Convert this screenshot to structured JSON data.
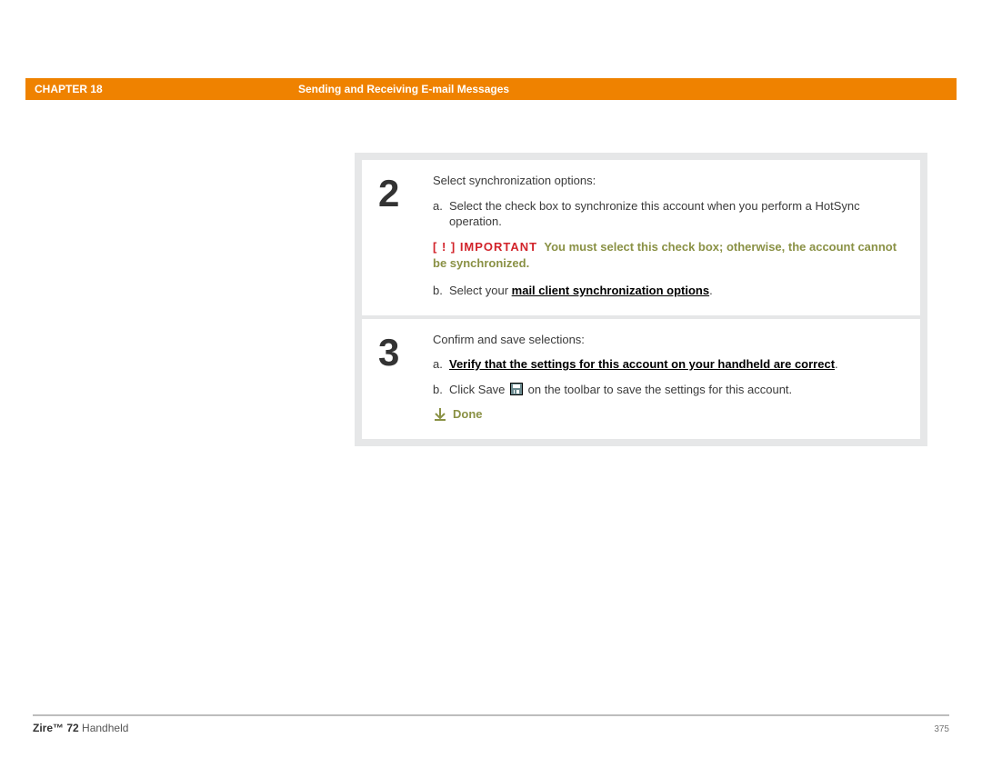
{
  "header": {
    "chapter_label": "CHAPTER 18",
    "title": "Sending and Receiving E-mail Messages"
  },
  "steps": [
    {
      "number": "2",
      "lead": "Select synchronization options:",
      "item_a_letter": "a.",
      "item_a_text": "Select the check box to synchronize this account when you perform a HotSync operation.",
      "important_tag": "[ ! ] IMPORTANT",
      "important_text": "You must select this check box; otherwise, the account cannot be synchronized.",
      "item_b_letter": "b.",
      "item_b_prefix": "Select your ",
      "item_b_link": "mail client synchronization options",
      "item_b_suffix": "."
    },
    {
      "number": "3",
      "lead": "Confirm and save selections:",
      "item_a_letter": "a.",
      "item_a_link": "Verify that the settings for this account on your handheld are correct",
      "item_a_suffix": ".",
      "item_b_letter": "b.",
      "item_b_prefix": "Click Save ",
      "item_b_suffix": " on the toolbar to save the settings for this account.",
      "done_label": "Done"
    }
  ],
  "footer": {
    "product_bold": "Zire™ 72",
    "product_rest": " Handheld",
    "page_number": "375"
  }
}
